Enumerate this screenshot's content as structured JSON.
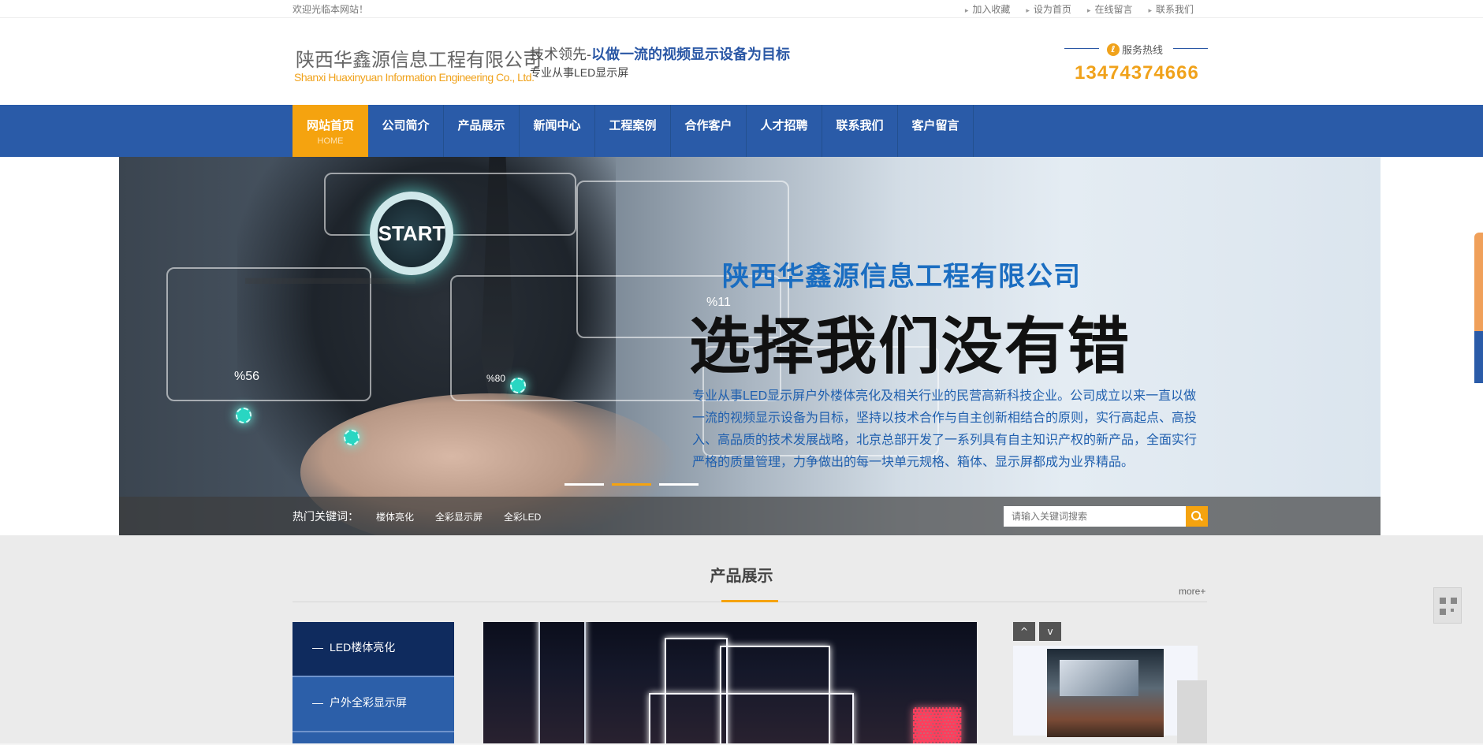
{
  "topbar": {
    "welcome": "欢迎光临本网站！",
    "links": [
      "加入收藏",
      "设为首页",
      "在线留言",
      "联系我们"
    ]
  },
  "header": {
    "logo_cn": "陕西华鑫源信息工程有限公司",
    "logo_en": "Shanxi  Huaxinyuan Information Engineering Co., Ltd.",
    "slogan_prefix": "技术领先-",
    "slogan_highlight": "以做一流的视频显示设备为目标",
    "slogan_sub": "专业从事LED显示屏",
    "hotline_label": "服务热线",
    "hotline_number": "13474374666"
  },
  "nav": {
    "items": [
      {
        "label": "网站首页",
        "sub": "HOME"
      },
      {
        "label": "公司简介"
      },
      {
        "label": "产品展示"
      },
      {
        "label": "新闻中心"
      },
      {
        "label": "工程案例"
      },
      {
        "label": "合作客户"
      },
      {
        "label": "人才招聘"
      },
      {
        "label": "联系我们"
      },
      {
        "label": "客户留言"
      }
    ]
  },
  "banner": {
    "start_label": "START",
    "company": "陕西华鑫源信息工程有限公司",
    "title": "选择我们没有错",
    "desc": "专业从事LED显示屏户外楼体亮化及相关行业的民营高新科技企业。公司成立以来一直以做一流的视频显示设备为目标，坚持以技术合作与自主创新相结合的原则，实行高起点、高投入、高品质的技术发展战略，北京总部开发了一系列具有自主知识产权的新产品，全面实行严格的质量管理，力争做出的每一块单元规格、箱体、显示屏都成为业界精品。",
    "percent_labels": [
      "%11",
      "%56",
      "%80"
    ],
    "slide_count": 3,
    "active_slide": 2
  },
  "keywords": {
    "label": "热门关键词：",
    "items": [
      "楼体亮化",
      "全彩显示屏",
      "全彩LED"
    ],
    "search_placeholder": "请输入关键词搜索"
  },
  "products": {
    "title": "产品展示",
    "more": "more+",
    "categories": [
      "LED楼体亮化",
      "户外全彩显示屏"
    ],
    "prev_label": "^",
    "next_label": "v"
  },
  "colors": {
    "nav_blue": "#2a5ba8",
    "accent_orange": "#f5a30f",
    "category_dark": "#0f2b5e"
  }
}
